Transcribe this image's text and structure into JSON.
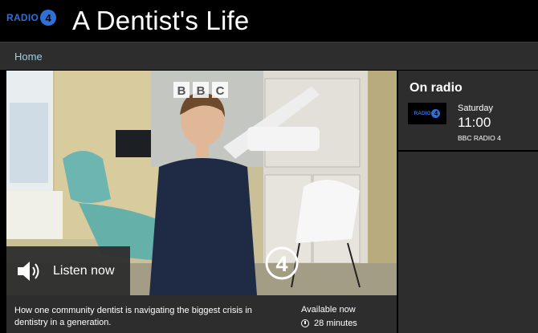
{
  "masthead": {
    "station_logo_text": "RADIO",
    "station_logo_number": "4",
    "title": "A Dentist's Life"
  },
  "nav": {
    "home_label": "Home"
  },
  "hero": {
    "image_icon": "dentist-clinic-photo",
    "watermark_text": "BBC",
    "channel_badge": "4",
    "listen_label": "Listen now",
    "listen_icon": "speaker-icon"
  },
  "episode": {
    "description": "How one community dentist is navigating the biggest crisis in dentistry in a generation.",
    "availability": "Available now",
    "duration": "28 minutes",
    "duration_icon": "clock-icon"
  },
  "on_radio": {
    "heading": "On radio",
    "logo_text": "RADIO",
    "logo_number": "4",
    "day": "Saturday",
    "time": "11:00",
    "station": "BBC RADIO 4"
  },
  "colors": {
    "brand_blue": "#2f6fd8",
    "panel_bg": "#2d2d2d",
    "link": "#9fd0df"
  }
}
